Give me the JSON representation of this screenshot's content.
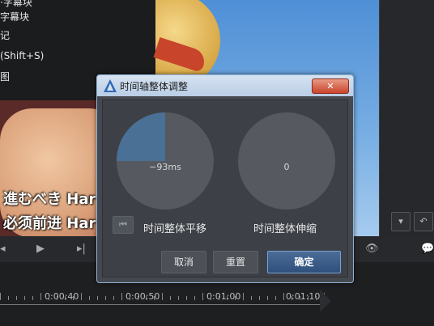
{
  "menu": {
    "items": [
      "·字幕块",
      "字幕块",
      "记",
      "(Shift+S)",
      "图"
    ]
  },
  "preview": {
    "subtitle_jp": "進むべき Har",
    "subtitle_cn": "必须前进 Har"
  },
  "timeline": {
    "labels": [
      "0:00:40",
      "0:00:50",
      "0:01:00",
      "0:01:10"
    ]
  },
  "dialog": {
    "title": "时间轴整体调整",
    "close_glyph": "✕",
    "shift_value": "−93ms",
    "scale_value": "0",
    "shift_label": "时间整体平移",
    "scale_label": "时间整体伸缩",
    "skip_glyph": "⏮",
    "cancel_label": "取消",
    "reset_label": "重置",
    "ok_label": "确定",
    "shift_dial_fill_fraction": 0.25
  },
  "colors": {
    "dial_bg": "#565a60",
    "dial_fill": "#4a7096",
    "accent": "#4c6c98"
  }
}
